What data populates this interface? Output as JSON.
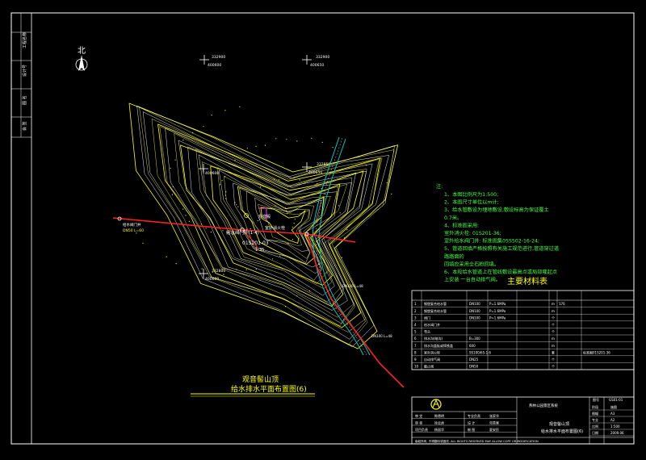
{
  "north_label": "北",
  "coords": {
    "top_left": {
      "x": "332900",
      "y": "400600"
    },
    "top_right": {
      "x": "332900",
      "y": "400650"
    },
    "mid_left": {
      "y": "400600"
    },
    "mid_right": {
      "x": "332850",
      "y": "400650"
    },
    "low_left": {
      "x": "332800",
      "y": "400600"
    }
  },
  "map_labels": {
    "valve_left": "给水阀门井",
    "pipe_spec": "DN50 L=60",
    "valve_center": "给水阀门井(1-4)",
    "building": "观音殿",
    "hydrant": "室外消火栓",
    "std_code": "01S201-03",
    "std_sub": "1-35",
    "right_pipe": "DN100 L=48",
    "lower_pipe": "DN100 L=48"
  },
  "notes": {
    "heading": "注:",
    "lines": [
      "1、本图比例尺为1:500;",
      "2、本图尺寸单位以m计;",
      "3、给水管敷设为埋地敷设,敷设标高为保证覆土",
      "   0.7米。",
      "4、标准图采用:",
      "   室外消火栓: 01S201-36;",
      "   室外给水阀门井: 标准图集05S502-16-24;",
      "5、管道回填严格按照有关施工规范进行,管道穿过道",
      "   路路面的",
      "   回填应采用全石粉回填。",
      "6、本段给水管道上在管线敷设最高点或局部隆起点",
      "   上安装    一台自动排气阀。"
    ]
  },
  "materials": {
    "title": "主要材料表",
    "rows": [
      [
        "1",
        "钢塑复合给水管",
        "DN100",
        "P=1.6MPa",
        "m",
        "176",
        ""
      ],
      [
        "2",
        "钢塑复合给水管",
        "DN100",
        "P=1.6MPa",
        "m",
        "",
        ""
      ],
      [
        "3",
        "阀门",
        "DN100",
        "P=1.6MPa",
        "个",
        "",
        ""
      ],
      [
        "4",
        "给水阀门井",
        "",
        "",
        "个",
        "",
        ""
      ],
      [
        "5",
        "弯头",
        "",
        "",
        "个",
        "",
        ""
      ],
      [
        "6",
        "排水沟(暗沟)",
        "B=300",
        "",
        "m",
        "",
        ""
      ],
      [
        "7",
        "排水沟盖板或铸铁盖",
        "600",
        "",
        "m",
        "",
        ""
      ],
      [
        "8",
        "室外消火栓",
        "SS100/65-1.6",
        "",
        "套",
        "",
        "标准图01S201-36"
      ],
      [
        "9",
        "自动排气阀",
        "DN25",
        "",
        "个",
        "",
        ""
      ],
      [
        "10",
        "截止阀",
        "DN50",
        "",
        "个",
        "",
        ""
      ]
    ]
  },
  "drawing_title": {
    "line1": "观音髻山顶",
    "line2": "给水排水平面布置图(6)"
  },
  "title_block": {
    "company": "燕林公园景区系统",
    "drawing_no_label": "图号",
    "drawing_no": "GS01-01",
    "rows_left": [
      [
        "审 定",
        "陈德明"
      ],
      [
        "审 核",
        "徐云虎"
      ],
      [
        "项目负责",
        "杨丽华"
      ]
    ],
    "rows_mid": [
      [
        "专业负责",
        "张家华"
      ],
      [
        "设 计",
        "邓贵果"
      ],
      [
        "制 图",
        "夏安民"
      ]
    ],
    "project_title": "观音髻山顶",
    "project_sub": "给水排水平面布置图(6)",
    "meta": [
      [
        "阶段",
        "施图"
      ],
      [
        "图幅",
        "A3"
      ],
      [
        "专业",
        "A2"
      ],
      [
        "比例",
        "1:500"
      ],
      [
        "日期",
        "2009.06"
      ]
    ],
    "footer": "版权所有, 不得翻印或做改. ALL RIGHTS RESERVED  MAY ALLOW COPY OR MODIFICATION"
  },
  "side_stamp": [
    "工程名称",
    "设计号",
    "图 名",
    "会 签"
  ],
  "colors": {
    "background": "#000000",
    "contour_major": "#ffff00",
    "contour_minor": "#ffffff",
    "pipe": "#ff2020",
    "road": "#00c8c8",
    "notes": "#40ff40",
    "title": "#ffff00",
    "frame": "#ffffff"
  }
}
